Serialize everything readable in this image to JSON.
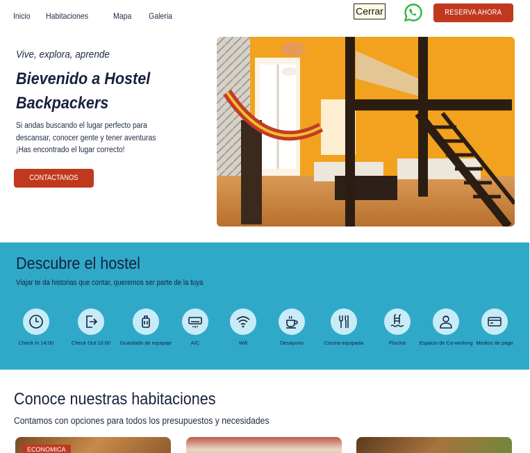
{
  "nav": {
    "links": [
      "Inicio",
      "Habitaciones",
      "Mapa",
      "Galeria"
    ],
    "close_label": "Cerrar",
    "reserve_label": "RESERVA AHORA"
  },
  "hero": {
    "tagline": "Vive, explora, aprende",
    "title": "Bievenido a Hostel Backpackers",
    "text": "Si andas buscando el lugar perfecto para descansar, conocer gente y tener aventuras ¡Has encontrado el lugar correcto!",
    "contact_label": "CONTACTANOS"
  },
  "discover": {
    "title": "Descubre el hostel",
    "subtitle": "Viajar te da historias que contar, queremos ser parte de la tuya",
    "amenities": [
      {
        "label": "Check In 14:00",
        "icon": "clock-icon"
      },
      {
        "label": "Check Out 10:00",
        "icon": "exit-icon"
      },
      {
        "label": "Guardado de equipaje",
        "icon": "luggage-icon"
      },
      {
        "label": "A/C",
        "icon": "air-conditioner-icon"
      },
      {
        "label": "Wifi",
        "icon": "wifi-icon"
      },
      {
        "label": "Desayuno",
        "icon": "coffee-icon"
      },
      {
        "label": "Cocina equipada",
        "icon": "utensils-icon"
      },
      {
        "label": "Piscina",
        "icon": "pool-icon"
      },
      {
        "label": "Espacio de Co-working",
        "icon": "person-icon"
      },
      {
        "label": "Medios de pago",
        "icon": "card-icon"
      }
    ]
  },
  "rooms": {
    "title": "Conoce nuestras habitaciones",
    "subtitle": "Contamos con opciones para todos los presupuestos y necesidades",
    "badge": "ECONOMICA"
  },
  "colors": {
    "accent": "#c0391f",
    "band": "#30a9c9",
    "icon_bg": "#c7ecf7",
    "text": "#16213e"
  }
}
